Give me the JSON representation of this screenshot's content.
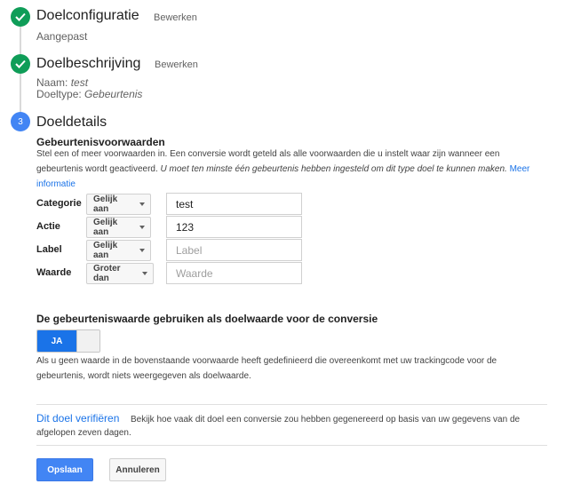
{
  "steps": [
    {
      "title": "Doelconfiguratie",
      "edit_label": "Bewerken",
      "summary": "Aangepast"
    },
    {
      "title": "Doelbeschrijving",
      "edit_label": "Bewerken",
      "name_label": "Naam:",
      "name_value": "test",
      "type_label": "Doeltype:",
      "type_value": "Gebeurtenis"
    },
    {
      "number": "3",
      "title": "Doeldetails"
    }
  ],
  "conditions_section": {
    "heading": "Gebeurtenisvoorwaarden",
    "description_1": "Stel een of meer voorwaarden in. Een conversie wordt geteld als alle voorwaarden die u instelt waar zijn wanneer een gebeurtenis wordt geactiveerd.",
    "description_italic": "U moet ten minste één gebeurtenis hebben ingesteld om dit type doel te kunnen maken.",
    "more_info_link": "Meer informatie"
  },
  "conditions": [
    {
      "label": "Categorie",
      "operator": "Gelijk aan",
      "value": "test",
      "placeholder": ""
    },
    {
      "label": "Actie",
      "operator": "Gelijk aan",
      "value": "123",
      "placeholder": ""
    },
    {
      "label": "Label",
      "operator": "Gelijk aan",
      "value": "",
      "placeholder": "Label"
    },
    {
      "label": "Waarde",
      "operator": "Groter dan",
      "value": "",
      "placeholder": "Waarde"
    }
  ],
  "goal_value": {
    "heading": "De gebeurteniswaarde gebruiken als doelwaarde voor de conversie",
    "toggle_label": "JA",
    "toggle_state": "on",
    "help_text": "Als u geen waarde in de bovenstaande voorwaarde heeft gedefinieerd die overeenkomt met uw trackingcode voor de gebeurtenis, wordt niets weergegeven als doelwaarde."
  },
  "verify": {
    "link": "Dit doel verifiëren",
    "text_line1": "Bekijk hoe vaak dit doel een conversie zou hebben gegenereerd op basis van uw gegevens van de",
    "text_line2": "afgelopen zeven dagen."
  },
  "actions": {
    "save": "Opslaan",
    "cancel": "Annuleren"
  },
  "colors": {
    "done": "#0f9d58",
    "current": "#4285f4",
    "link": "#1a73e8",
    "primary": "#4285f4"
  }
}
